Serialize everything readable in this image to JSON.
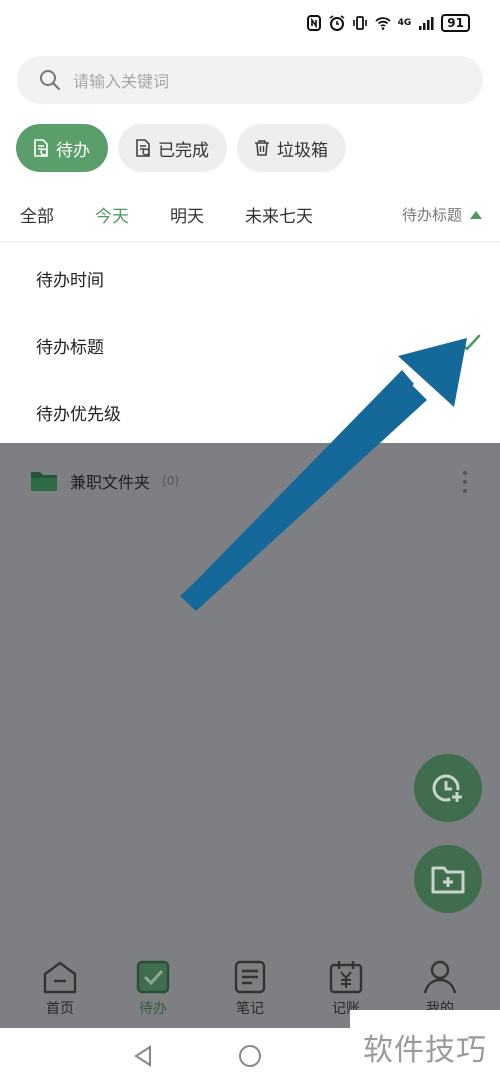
{
  "status_bar": {
    "battery": "91",
    "network": "4G"
  },
  "search": {
    "placeholder": "请输入关键词"
  },
  "status_filters": [
    {
      "label": "待办",
      "icon": "todo-doc-icon",
      "active": true
    },
    {
      "label": "已完成",
      "icon": "done-doc-icon",
      "active": false
    },
    {
      "label": "垃圾箱",
      "icon": "trash-icon",
      "active": false
    }
  ],
  "date_tabs": [
    {
      "label": "全部",
      "active": false
    },
    {
      "label": "今天",
      "active": true
    },
    {
      "label": "明天",
      "active": false
    },
    {
      "label": "未来七天",
      "active": false
    }
  ],
  "sort": {
    "label": "待办标题",
    "direction": "ascending"
  },
  "sort_menu": {
    "items": [
      {
        "label": "待办时间",
        "selected": false
      },
      {
        "label": "待办标题",
        "selected": true
      },
      {
        "label": "待办优先级",
        "selected": false
      }
    ]
  },
  "folder": {
    "name": "兼职文件夹",
    "count": "(0)"
  },
  "fabs": [
    {
      "icon": "add-reminder-icon"
    },
    {
      "icon": "add-folder-icon"
    }
  ],
  "bottom_nav": [
    {
      "label": "首页",
      "icon": "home-icon",
      "active": false
    },
    {
      "label": "待办",
      "icon": "checkbox-icon",
      "active": true
    },
    {
      "label": "笔记",
      "icon": "notes-icon",
      "active": false
    },
    {
      "label": "记账",
      "icon": "ledger-icon",
      "active": false
    },
    {
      "label": "我的",
      "icon": "profile-icon",
      "active": false
    }
  ],
  "watermark": "软件技巧",
  "colors": {
    "accent": "#5a9e6c",
    "overlay": "#7e7f82",
    "arrow": "#14699a"
  }
}
